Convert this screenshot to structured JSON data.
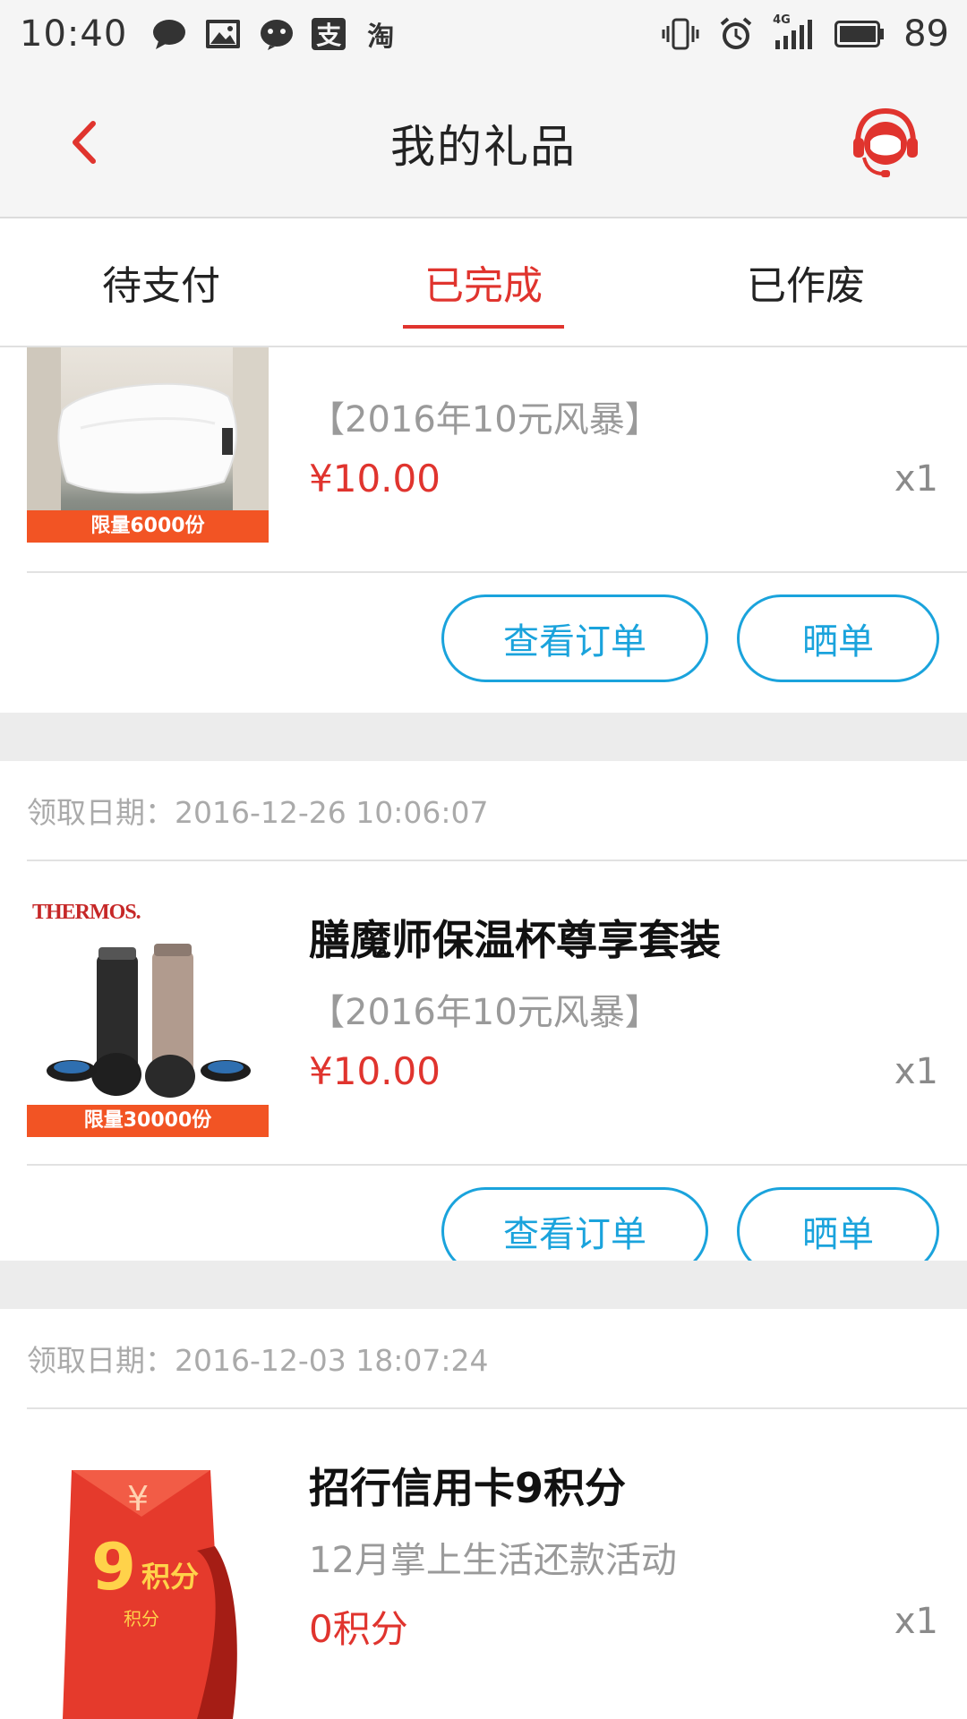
{
  "status_bar": {
    "time": "10:40",
    "left_icons": [
      "chat-bubble-icon",
      "image-icon",
      "wechat-icon",
      "alipay-icon",
      "taobao-icon"
    ],
    "alipay_glyph": "支",
    "taobao_glyph": "淘",
    "network_label": "4G",
    "battery": "89"
  },
  "header": {
    "title": "我的礼品",
    "accent_color": "#e0342e"
  },
  "tabs": [
    {
      "label": "待支付",
      "active": false
    },
    {
      "label": "已完成",
      "active": true
    },
    {
      "label": "已作废",
      "active": false
    }
  ],
  "orders": [
    {
      "date": "",
      "name": "",
      "campaign": "【2016年10元风暴】",
      "price": "¥10.00",
      "qty": "x1",
      "badge": "限量6000份",
      "view_order_label": "查看订单",
      "share_label": "晒单"
    },
    {
      "date": "领取日期：2016-12-26 10:06:07",
      "name": "膳魔师保温杯尊享套装",
      "campaign": "【2016年10元风暴】",
      "price": "¥10.00",
      "qty": "x1",
      "badge": "限量30000份",
      "brand": "THERMOS.",
      "view_order_label": "查看订单",
      "share_label": "晒单"
    },
    {
      "date": "领取日期：2016-12-03 18:07:24",
      "name": "招行信用卡9积分",
      "campaign": "12月掌上生活还款活动",
      "price": "0积分",
      "qty": "x1",
      "envelope_symbol": "¥",
      "envelope_number": "9",
      "envelope_unit": "积分",
      "envelope_footer": "积分"
    }
  ],
  "colors": {
    "link_blue": "#1aa3dc",
    "badge_orange": "#f25424",
    "separator_gray": "#ececec"
  }
}
